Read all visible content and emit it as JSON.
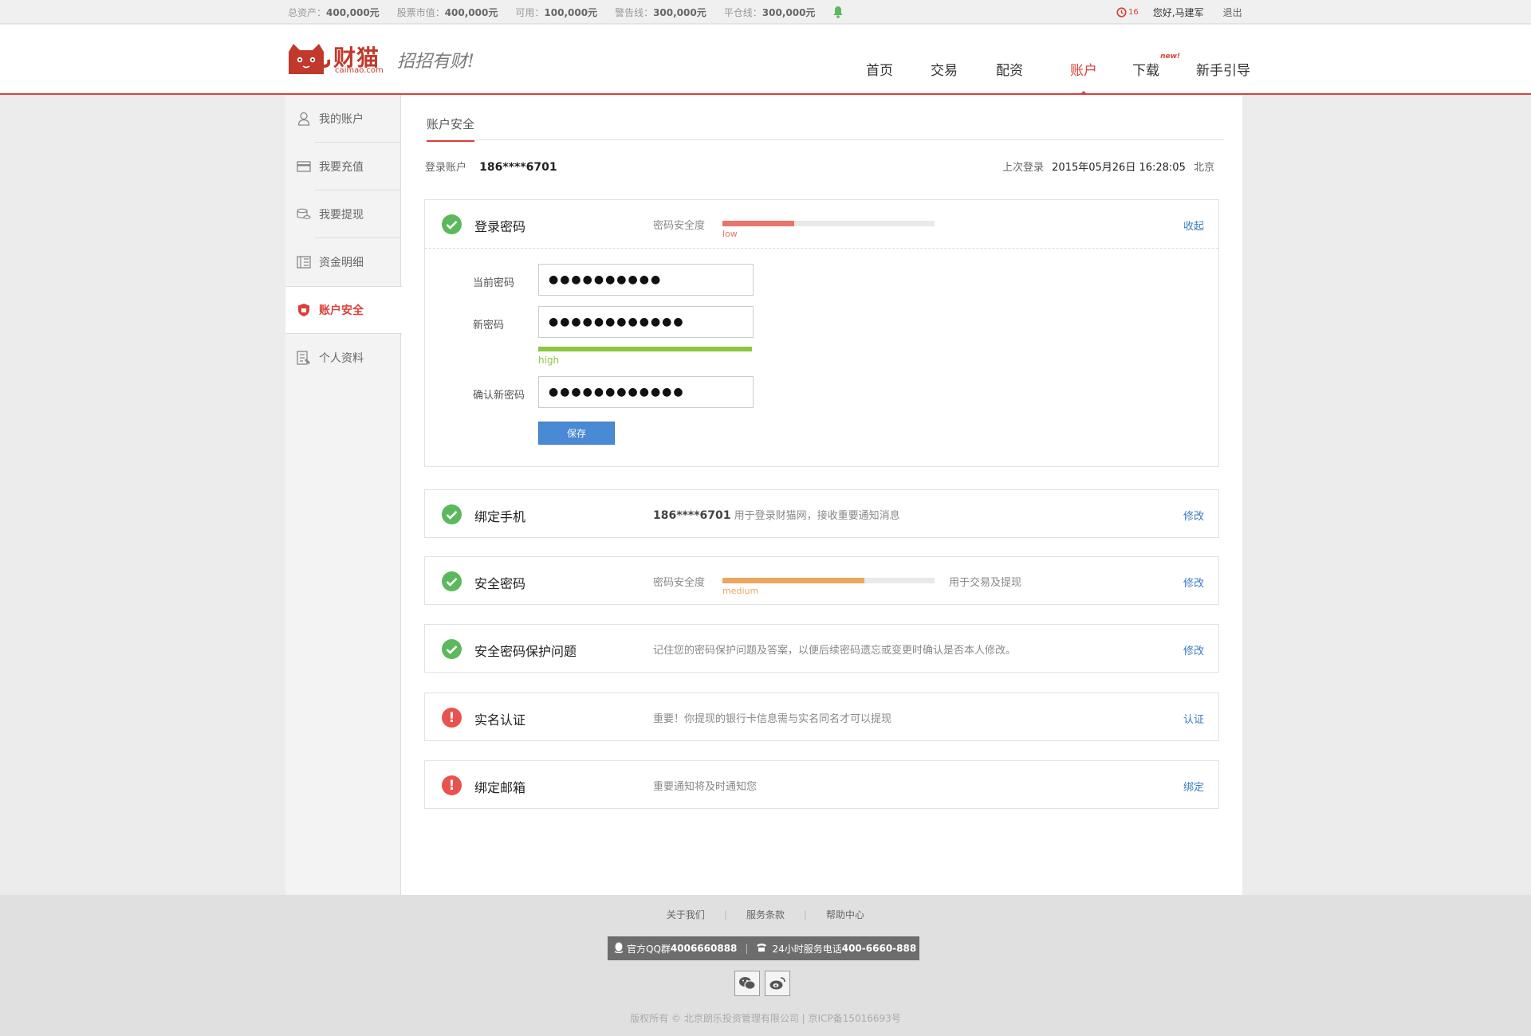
{
  "topbar": {
    "stats": [
      {
        "label": "总资产：",
        "value": "400,000元"
      },
      {
        "label": "股票市值：",
        "value": "400,000元"
      },
      {
        "label": "可用：",
        "value": "100,000元"
      },
      {
        "label": "警告线：",
        "value": "300,000元"
      },
      {
        "label": "平仓线：",
        "value": "300,000元"
      }
    ],
    "notice_count": "16",
    "greeting": "您好,马建军",
    "logout": "退出"
  },
  "header": {
    "logo_name": "财猫",
    "logo_domain": "caimao.com",
    "slogan": "招招有财!",
    "nav": [
      "首页",
      "交易",
      "配资",
      "账户",
      "下载",
      "新手引导"
    ],
    "nav_new_badge": "new!",
    "nav_active": "账户"
  },
  "sidebar": {
    "items": [
      {
        "label": "我的账户",
        "icon": "user-icon"
      },
      {
        "label": "我要充值",
        "icon": "card-icon"
      },
      {
        "label": "我要提现",
        "icon": "coins-icon"
      },
      {
        "label": "资金明细",
        "icon": "ledger-icon"
      },
      {
        "label": "账户安全",
        "icon": "shield-icon",
        "active": true
      },
      {
        "label": "个人资料",
        "icon": "profile-icon"
      }
    ]
  },
  "content": {
    "tab_title": "账户安全",
    "login_account_label": "登录账户",
    "login_account": "186****6701",
    "last_login_label": "上次登录",
    "last_login_time": "2015年05月26日 16:28:05",
    "last_login_place": "北京"
  },
  "panels": {
    "login_pwd": {
      "title": "登录密码",
      "meter_label": "密码安全度",
      "strength": 0.34,
      "strength_text": "low",
      "strength_color": "#e8746a",
      "action": "收起",
      "form": {
        "current_label": "当前密码",
        "current_value": "●●●●●●●●●●",
        "new_label": "新密码",
        "new_value": "●●●●●●●●●●●●",
        "new_strength": 1.0,
        "new_strength_text": "high",
        "confirm_label": "确认新密码",
        "confirm_value": "●●●●●●●●●●●●",
        "save": "保存"
      }
    },
    "phone": {
      "title": "绑定手机",
      "number": "186****6701",
      "desc": "用于登录财猫网，接收重要通知消息",
      "action": "修改"
    },
    "safe_pwd": {
      "title": "安全密码",
      "meter_label": "密码安全度",
      "strength": 0.67,
      "strength_text": "medium",
      "strength_color": "#eba65e",
      "note": "用于交易及提现",
      "action": "修改"
    },
    "question": {
      "title": "安全密码保护问题",
      "desc": "记住您的密码保护问题及答案，以便后续密码遗忘或变更时确认是否本人修改。",
      "action": "修改"
    },
    "realname": {
      "title": "实名认证",
      "desc": "重要！你提现的银行卡信息需与实名同名才可以提现",
      "action": "认证"
    },
    "email": {
      "title": "绑定邮箱",
      "desc": "重要通知将及时通知您",
      "action": "绑定"
    }
  },
  "footer": {
    "links": [
      "关于我们",
      "服务条款",
      "帮助中心"
    ],
    "qq_label": "官方QQ群",
    "qq_number": "4006660888",
    "phone_label": "24小时服务电话",
    "phone_number": "400-6660-888",
    "copyright": "版权所有 © 北京朗乐投资管理有限公司 | 京ICP备15016693号"
  },
  "colors": {
    "brand": "#d9413a",
    "link": "#3b7bbf",
    "ok": "#5cb85c",
    "warn": "#e8534d",
    "primary_button": "#4a89d4"
  }
}
